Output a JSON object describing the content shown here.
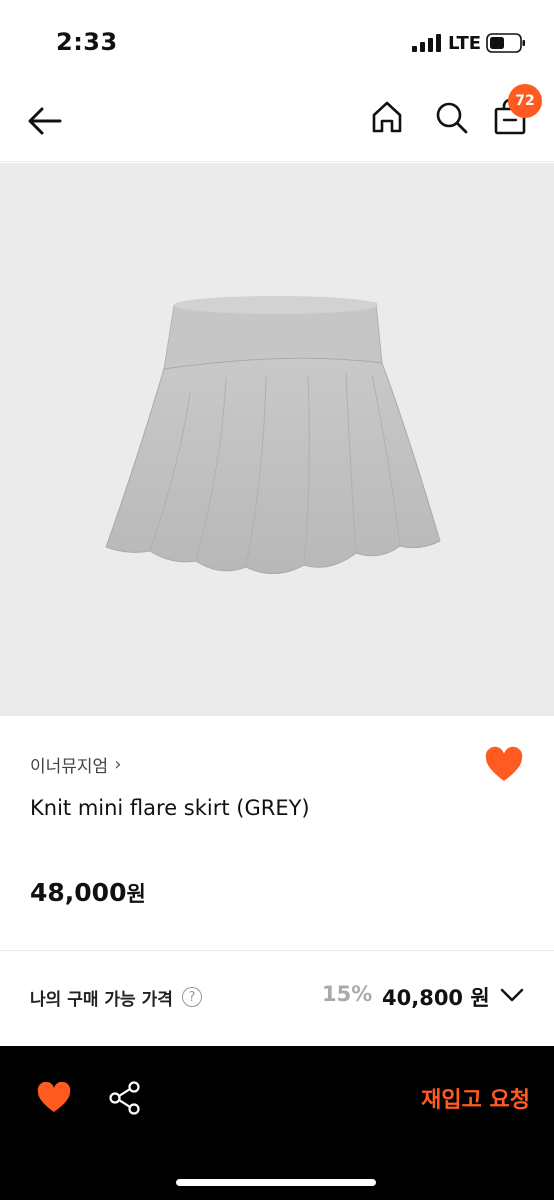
{
  "status_bar": {
    "time": "2:33",
    "network": "LTE"
  },
  "header": {
    "icons": [
      "back-arrow-icon",
      "home-icon",
      "search-icon",
      "shopping-bag-icon"
    ],
    "cart_count": "72",
    "badge_color": "#ff5a1f"
  },
  "product": {
    "brand": "이너뮤지엄",
    "brand_chevron": "›",
    "name": "Knit mini flare skirt (GREY)",
    "price": "48,000",
    "price_unit": "원",
    "liked": true
  },
  "my_price": {
    "label": "나의 구매 가능 가격",
    "help": "?",
    "discount": "15%",
    "final_price": "40,800 원"
  },
  "bottom_bar": {
    "restock_label": "재입고 요청",
    "accent": "#ff5a1f"
  }
}
